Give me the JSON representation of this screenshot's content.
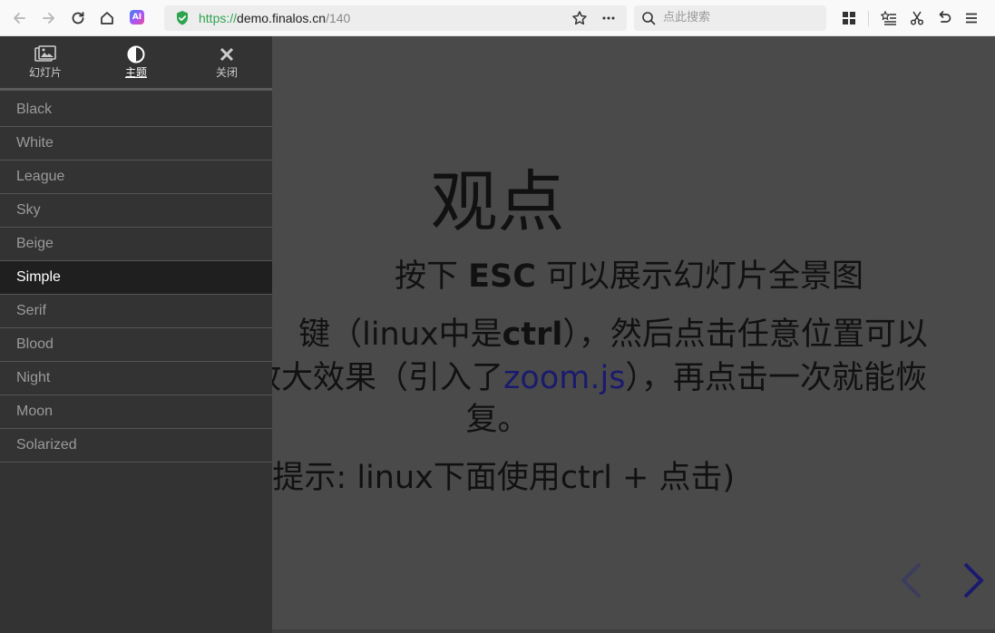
{
  "browser": {
    "url_scheme": "https://",
    "url_host": "demo.finalos.cn",
    "url_path": "/140",
    "search_placeholder": "点此搜索",
    "ai_badge": "AI"
  },
  "menu": {
    "tabs": [
      {
        "label": "幻灯片",
        "icon": "images-icon"
      },
      {
        "label": "主题",
        "icon": "half-circle-icon"
      },
      {
        "label": "关闭",
        "icon": "close-icon"
      }
    ],
    "active_tab": "主题",
    "themes": [
      "Black",
      "White",
      "League",
      "Sky",
      "Beige",
      "Simple",
      "Serif",
      "Blood",
      "Night",
      "Moon",
      "Solarized"
    ],
    "selected_theme": "Simple"
  },
  "slide": {
    "title": "观点",
    "line1_pre": "按下 ",
    "line1_bold": "ESC",
    "line1_post": " 可以展示幻灯片全景图",
    "line2_pre": "键（linux中是",
    "line2_bold": "ctrl",
    "line2_post": "），然后点击任意位置可以",
    "line3_pre": "放大效果（引入了",
    "line3_link": "zoom.js",
    "line3_post": "），再点击一次就能恢",
    "line4": "复。",
    "hint": "(提示: linux下面使用ctrl + 点击)"
  },
  "colors": {
    "page_bg": "#4a4a4a",
    "menu_bg": "#333333",
    "selected_bg": "#1f1f1f",
    "link": "#1a1a6e",
    "nav_arrow": "#1a1a6e"
  }
}
